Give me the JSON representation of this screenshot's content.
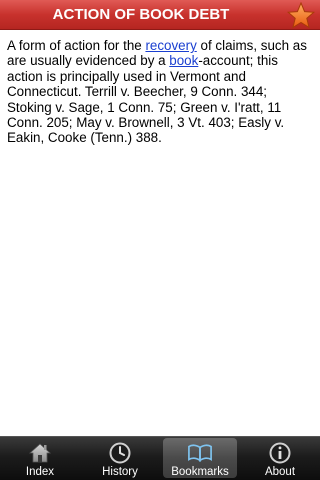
{
  "header": {
    "title": "ACTION OF BOOK DEBT",
    "star_icon": "star-icon"
  },
  "content": {
    "text_1": "A form of action for the ",
    "link_recovery": "recovery",
    "text_2": " of claims, such as are usually evidenced by a ",
    "link_book": "book",
    "text_3": "-account; this action is principally used in Vermont and Connecticut. Terrill v. Beecher, 9 Conn. 344; Stoking v. Sage, 1 Conn. 75; Green v. I'ratt, 11 Conn. 205; May v. Brownell, 3 Vt. 403; Easly v. Eakin, Cooke (Tenn.) 388."
  },
  "tabs": [
    {
      "label": "Index",
      "icon": "house-icon",
      "selected": false
    },
    {
      "label": "History",
      "icon": "clock-icon",
      "selected": false
    },
    {
      "label": "Bookmarks",
      "icon": "book-icon",
      "selected": true
    },
    {
      "label": "About",
      "icon": "info-icon",
      "selected": false
    }
  ],
  "colors": {
    "header": "#c8322d",
    "link": "#1a3fd0",
    "tabbar": "#1c1c1c",
    "star": "#f07a20"
  }
}
